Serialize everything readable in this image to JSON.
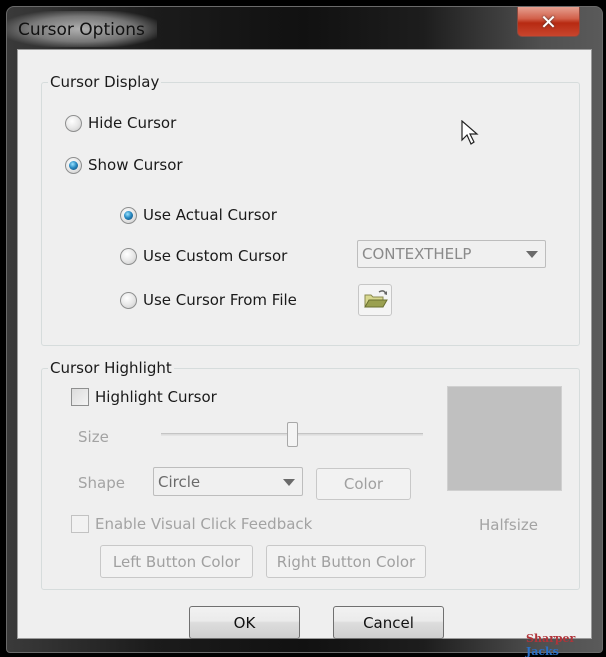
{
  "window": {
    "title": "Cursor Options",
    "close_label": "✕"
  },
  "cursor_display": {
    "group_label": "Cursor Display",
    "visibility_options": [
      {
        "label": "Hide Cursor",
        "checked": false
      },
      {
        "label": "Show Cursor",
        "checked": true
      }
    ],
    "source_options": [
      {
        "label": "Use Actual Cursor",
        "checked": true
      },
      {
        "label": "Use Custom Cursor",
        "checked": false
      },
      {
        "label": "Use Cursor From File",
        "checked": false
      }
    ],
    "custom_cursor_select": {
      "value": "CONTEXTHELP"
    },
    "browse_icon": "folder-open-icon"
  },
  "cursor_highlight": {
    "group_label": "Cursor Highlight",
    "highlight_checkbox": {
      "label": "Highlight Cursor",
      "checked": false
    },
    "size_label": "Size",
    "size_slider_fraction": 0.5,
    "shape_label": "Shape",
    "shape_select": {
      "value": "Circle"
    },
    "color_button": "Color",
    "preview_color": "#c0c0c0",
    "preview_caption": "Halfsize",
    "click_feedback_checkbox": {
      "label": "Enable Visual Click Feedback",
      "checked": false
    },
    "left_button_color": "Left Button Color",
    "right_button_color": "Right Button Color"
  },
  "footer": {
    "ok": "OK",
    "cancel": "Cancel"
  },
  "watermark": {
    "part1": "Sharper",
    "part2": "Jacks"
  }
}
